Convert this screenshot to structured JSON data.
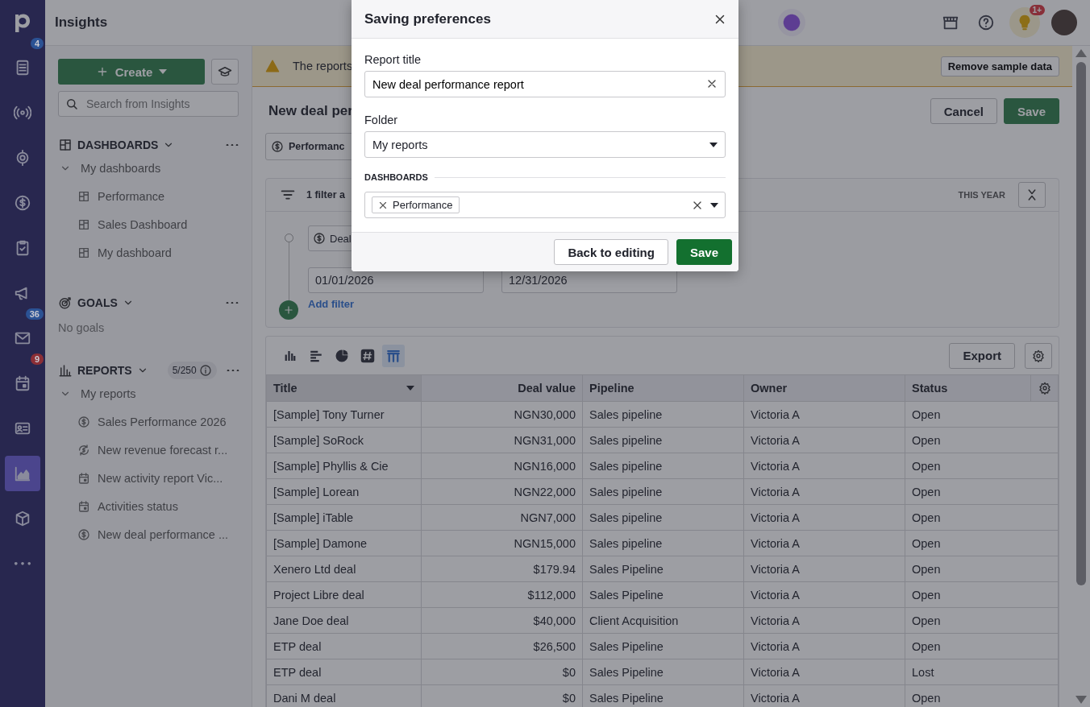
{
  "app_rail": {
    "items": [
      {
        "badge": {
          "text": "4",
          "color": "#2b5294"
        },
        "selected": false
      },
      {
        "selected": false
      },
      {
        "selected": false
      },
      {
        "selected": false
      },
      {
        "selected": false
      },
      {
        "selected": false
      },
      {
        "badge": {
          "text": "36",
          "color": "#2b5294"
        },
        "selected": false
      },
      {
        "badge": {
          "text": "9",
          "color": "#8c2f36"
        },
        "selected": false
      },
      {
        "selected": false
      },
      {
        "selected": true
      },
      {
        "selected": false
      },
      {
        "selected": false
      }
    ]
  },
  "top_bar": {
    "title": "Insights",
    "tips_badge": "1+"
  },
  "sidebar": {
    "create_button": "Create",
    "search": {
      "placeholder": "Search from Insights"
    },
    "dashboards": {
      "title": "DASHBOARDS",
      "folder": {
        "label": "My dashboards",
        "expanded": true,
        "items": [
          "Performance",
          "Sales Dashboard",
          "My dashboard"
        ]
      }
    },
    "goals": {
      "title": "GOALS",
      "empty_text": "No goals"
    },
    "reports": {
      "title": "REPORTS",
      "count": "5/250",
      "folder": {
        "label": "My reports",
        "expanded": true,
        "items": [
          {
            "label": "Sales Performance 2026",
            "kind": "deal"
          },
          {
            "label": "New revenue forecast r...",
            "kind": "forecast"
          },
          {
            "label": "New activity report Vic...",
            "kind": "activity"
          },
          {
            "label": "Activities status",
            "kind": "activity"
          },
          {
            "label": "New deal performance ...",
            "kind": "deal"
          }
        ]
      }
    }
  },
  "banner": {
    "text": "The reports",
    "button": "Remove sample data"
  },
  "report_header": {
    "title": "New deal per",
    "cancel": "Cancel",
    "save": "Save",
    "chip": "Performanc"
  },
  "filters": {
    "summary": "1 filter a",
    "period": "THIS YEAR",
    "field": "Deal",
    "date_from": "01/01/2026",
    "date_to": "12/31/2026",
    "add_filter": "Add filter"
  },
  "chart_toolbar": {
    "view_types": [
      {
        "kind": "column",
        "selected": false
      },
      {
        "kind": "bar",
        "selected": false
      },
      {
        "kind": "pie",
        "selected": false
      },
      {
        "kind": "number",
        "selected": false
      },
      {
        "kind": "table",
        "selected": true
      }
    ],
    "export": "Export"
  },
  "table": {
    "columns": [
      "Title",
      "Deal value",
      "Pipeline",
      "Owner",
      "Status"
    ],
    "rows": [
      [
        "[Sample] Tony Turner",
        "NGN30,000",
        "Sales pipeline",
        "Victoria A",
        "Open"
      ],
      [
        "[Sample] SoRock",
        "NGN31,000",
        "Sales pipeline",
        "Victoria A",
        "Open"
      ],
      [
        "[Sample] Phyllis & Cie",
        "NGN16,000",
        "Sales pipeline",
        "Victoria A",
        "Open"
      ],
      [
        "[Sample] Lorean",
        "NGN22,000",
        "Sales pipeline",
        "Victoria A",
        "Open"
      ],
      [
        "[Sample] iTable",
        "NGN7,000",
        "Sales pipeline",
        "Victoria A",
        "Open"
      ],
      [
        "[Sample] Damone",
        "NGN15,000",
        "Sales pipeline",
        "Victoria A",
        "Open"
      ],
      [
        "Xenero Ltd deal",
        "$179.94",
        "Sales Pipeline",
        "Victoria A",
        "Open"
      ],
      [
        "Project Libre deal",
        "$112,000",
        "Sales Pipeline",
        "Victoria A",
        "Open"
      ],
      [
        "Jane Doe deal",
        "$40,000",
        "Client Acquisition",
        "Victoria A",
        "Open"
      ],
      [
        "ETP deal",
        "$26,500",
        "Sales Pipeline",
        "Victoria A",
        "Open"
      ],
      [
        "ETP deal",
        "$0",
        "Sales Pipeline",
        "Victoria A",
        "Lost"
      ],
      [
        "Dani M deal",
        "$0",
        "Sales Pipeline",
        "Victoria A",
        "Open"
      ]
    ]
  },
  "dialog": {
    "title": "Saving preferences",
    "report_title_label": "Report title",
    "report_title_value": "New deal performance report",
    "folder_label": "Folder",
    "folder_value": "My reports",
    "dashboards_label": "DASHBOARDS",
    "dashboard_tags": [
      "Performance"
    ],
    "back_button": "Back to editing",
    "save_button": "Save"
  }
}
